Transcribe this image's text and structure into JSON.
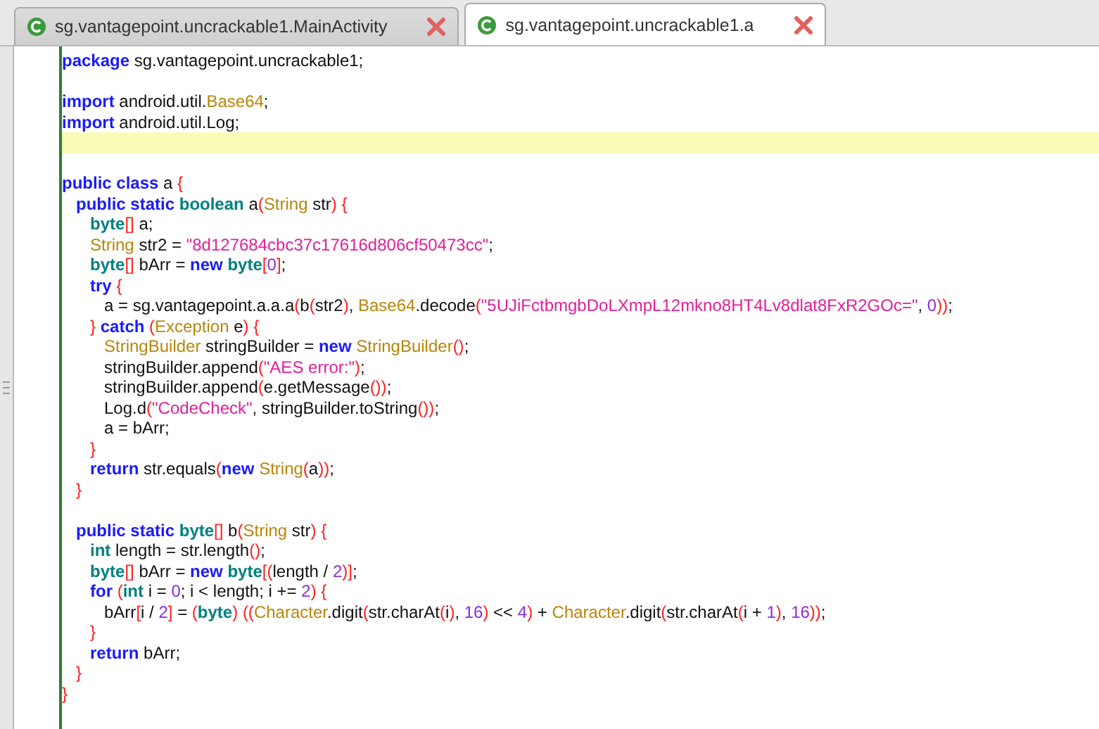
{
  "tabs": [
    {
      "label": "sg.vantagepoint.uncrackable1.MainActivity",
      "selected": false
    },
    {
      "label": "sg.vantagepoint.uncrackable1.a",
      "selected": true
    }
  ],
  "editor": {
    "lines": [
      {
        "highlighted": false,
        "tokens": [
          {
            "kind": "kw",
            "text": "package"
          },
          {
            "kind": "plain",
            "text": " sg.vantagepoint.uncrackable1;"
          }
        ]
      },
      {
        "highlighted": false
      },
      {
        "highlighted": false,
        "tokens": [
          {
            "kind": "kw",
            "text": "import"
          },
          {
            "kind": "plain",
            "text": " android.util."
          },
          {
            "kind": "cls",
            "text": "Base64"
          },
          {
            "kind": "plain",
            "text": ";"
          }
        ]
      },
      {
        "highlighted": false,
        "tokens": [
          {
            "kind": "kw",
            "text": "import"
          },
          {
            "kind": "plain",
            "text": " android.util.Log;"
          }
        ]
      },
      {
        "highlighted": true
      },
      {
        "highlighted": false
      },
      {
        "highlighted": false,
        "tokens": [
          {
            "kind": "kw",
            "text": "public class"
          },
          {
            "kind": "plain",
            "text": " a "
          },
          {
            "kind": "punc",
            "text": "{"
          }
        ]
      },
      {
        "highlighted": false,
        "tokens": [
          {
            "kind": "kw",
            "text": "   public static "
          },
          {
            "kind": "type",
            "text": "boolean"
          },
          {
            "kind": "plain",
            "text": " a"
          },
          {
            "kind": "punc",
            "text": "("
          },
          {
            "kind": "cls",
            "text": "String"
          },
          {
            "kind": "plain",
            "text": " str"
          },
          {
            "kind": "punc",
            "text": ") {"
          }
        ]
      },
      {
        "highlighted": false,
        "tokens": [
          {
            "kind": "type",
            "text": "      byte"
          },
          {
            "kind": "punc",
            "text": "[]"
          },
          {
            "kind": "plain",
            "text": " a;"
          }
        ]
      },
      {
        "highlighted": false,
        "tokens": [
          {
            "kind": "cls",
            "text": "      String"
          },
          {
            "kind": "plain",
            "text": " str2 = "
          },
          {
            "kind": "str",
            "text": "\"8d127684cbc37c17616d806cf50473cc\""
          },
          {
            "kind": "plain",
            "text": ";"
          }
        ]
      },
      {
        "highlighted": false,
        "tokens": [
          {
            "kind": "type",
            "text": "      byte"
          },
          {
            "kind": "punc",
            "text": "[]"
          },
          {
            "kind": "plain",
            "text": " bArr = "
          },
          {
            "kind": "kw",
            "text": "new "
          },
          {
            "kind": "type",
            "text": "byte"
          },
          {
            "kind": "punc",
            "text": "["
          },
          {
            "kind": "num",
            "text": "0"
          },
          {
            "kind": "punc",
            "text": "]"
          },
          {
            "kind": "plain",
            "text": ";"
          }
        ]
      },
      {
        "highlighted": false,
        "tokens": [
          {
            "kind": "kw",
            "text": "      try "
          },
          {
            "kind": "punc",
            "text": "{"
          }
        ]
      },
      {
        "highlighted": false,
        "tokens": [
          {
            "kind": "plain",
            "text": "         a = sg.vantagepoint.a.a.a"
          },
          {
            "kind": "punc",
            "text": "("
          },
          {
            "kind": "plain",
            "text": "b"
          },
          {
            "kind": "punc",
            "text": "("
          },
          {
            "kind": "plain",
            "text": "str2"
          },
          {
            "kind": "punc",
            "text": ")"
          },
          {
            "kind": "plain",
            "text": ", "
          },
          {
            "kind": "cls",
            "text": "Base64"
          },
          {
            "kind": "plain",
            "text": ".decode"
          },
          {
            "kind": "punc",
            "text": "("
          },
          {
            "kind": "str",
            "text": "\"5UJiFctbmgbDoLXmpL12mkno8HT4Lv8dlat8FxR2GOc=\""
          },
          {
            "kind": "plain",
            "text": ", "
          },
          {
            "kind": "num",
            "text": "0"
          },
          {
            "kind": "punc",
            "text": "))"
          },
          {
            "kind": "plain",
            "text": ";"
          }
        ]
      },
      {
        "highlighted": false,
        "tokens": [
          {
            "kind": "punc",
            "text": "      } "
          },
          {
            "kind": "kw",
            "text": "catch "
          },
          {
            "kind": "punc",
            "text": "("
          },
          {
            "kind": "cls",
            "text": "Exception"
          },
          {
            "kind": "plain",
            "text": " e"
          },
          {
            "kind": "punc",
            "text": ") {"
          }
        ]
      },
      {
        "highlighted": false,
        "tokens": [
          {
            "kind": "cls",
            "text": "         StringBuilder"
          },
          {
            "kind": "plain",
            "text": " stringBuilder = "
          },
          {
            "kind": "kw",
            "text": "new "
          },
          {
            "kind": "cls",
            "text": "StringBuilder"
          },
          {
            "kind": "punc",
            "text": "()"
          },
          {
            "kind": "plain",
            "text": ";"
          }
        ]
      },
      {
        "highlighted": false,
        "tokens": [
          {
            "kind": "plain",
            "text": "         stringBuilder.append"
          },
          {
            "kind": "punc",
            "text": "("
          },
          {
            "kind": "str",
            "text": "\"AES error:\""
          },
          {
            "kind": "punc",
            "text": ")"
          },
          {
            "kind": "plain",
            "text": ";"
          }
        ]
      },
      {
        "highlighted": false,
        "tokens": [
          {
            "kind": "plain",
            "text": "         stringBuilder.append"
          },
          {
            "kind": "punc",
            "text": "("
          },
          {
            "kind": "plain",
            "text": "e.getMessage"
          },
          {
            "kind": "punc",
            "text": "())"
          },
          {
            "kind": "plain",
            "text": ";"
          }
        ]
      },
      {
        "highlighted": false,
        "tokens": [
          {
            "kind": "plain",
            "text": "         Log.d"
          },
          {
            "kind": "punc",
            "text": "("
          },
          {
            "kind": "str",
            "text": "\"CodeCheck\""
          },
          {
            "kind": "plain",
            "text": ", stringBuilder.toString"
          },
          {
            "kind": "punc",
            "text": "())"
          },
          {
            "kind": "plain",
            "text": ";"
          }
        ]
      },
      {
        "highlighted": false,
        "tokens": [
          {
            "kind": "plain",
            "text": "         a = bArr;"
          }
        ]
      },
      {
        "highlighted": false,
        "tokens": [
          {
            "kind": "punc",
            "text": "      }"
          }
        ]
      },
      {
        "highlighted": false,
        "tokens": [
          {
            "kind": "kw",
            "text": "      return"
          },
          {
            "kind": "plain",
            "text": " str.equals"
          },
          {
            "kind": "punc",
            "text": "("
          },
          {
            "kind": "kw",
            "text": "new "
          },
          {
            "kind": "cls",
            "text": "String"
          },
          {
            "kind": "punc",
            "text": "("
          },
          {
            "kind": "plain",
            "text": "a"
          },
          {
            "kind": "punc",
            "text": "))"
          },
          {
            "kind": "plain",
            "text": ";"
          }
        ]
      },
      {
        "highlighted": false,
        "tokens": [
          {
            "kind": "punc",
            "text": "   }"
          }
        ]
      },
      {
        "highlighted": false
      },
      {
        "highlighted": false,
        "tokens": [
          {
            "kind": "kw",
            "text": "   public static "
          },
          {
            "kind": "type",
            "text": "byte"
          },
          {
            "kind": "punc",
            "text": "[]"
          },
          {
            "kind": "plain",
            "text": " b"
          },
          {
            "kind": "punc",
            "text": "("
          },
          {
            "kind": "cls",
            "text": "String"
          },
          {
            "kind": "plain",
            "text": " str"
          },
          {
            "kind": "punc",
            "text": ") {"
          }
        ]
      },
      {
        "highlighted": false,
        "tokens": [
          {
            "kind": "type",
            "text": "      int"
          },
          {
            "kind": "plain",
            "text": " length = str.length"
          },
          {
            "kind": "punc",
            "text": "()"
          },
          {
            "kind": "plain",
            "text": ";"
          }
        ]
      },
      {
        "highlighted": false,
        "tokens": [
          {
            "kind": "type",
            "text": "      byte"
          },
          {
            "kind": "punc",
            "text": "[]"
          },
          {
            "kind": "plain",
            "text": " bArr = "
          },
          {
            "kind": "kw",
            "text": "new "
          },
          {
            "kind": "type",
            "text": "byte"
          },
          {
            "kind": "punc",
            "text": "[("
          },
          {
            "kind": "plain",
            "text": "length / "
          },
          {
            "kind": "num",
            "text": "2"
          },
          {
            "kind": "punc",
            "text": ")]"
          },
          {
            "kind": "plain",
            "text": ";"
          }
        ]
      },
      {
        "highlighted": false,
        "tokens": [
          {
            "kind": "kw",
            "text": "      for "
          },
          {
            "kind": "punc",
            "text": "("
          },
          {
            "kind": "type",
            "text": "int"
          },
          {
            "kind": "plain",
            "text": " i = "
          },
          {
            "kind": "num",
            "text": "0"
          },
          {
            "kind": "plain",
            "text": "; i < length; i += "
          },
          {
            "kind": "num",
            "text": "2"
          },
          {
            "kind": "punc",
            "text": ") {"
          }
        ]
      },
      {
        "highlighted": false,
        "tokens": [
          {
            "kind": "plain",
            "text": "         bArr"
          },
          {
            "kind": "punc",
            "text": "["
          },
          {
            "kind": "plain",
            "text": "i / "
          },
          {
            "kind": "num",
            "text": "2"
          },
          {
            "kind": "punc",
            "text": "]"
          },
          {
            "kind": "plain",
            "text": " = "
          },
          {
            "kind": "punc",
            "text": "("
          },
          {
            "kind": "type",
            "text": "byte"
          },
          {
            "kind": "punc",
            "text": ") (("
          },
          {
            "kind": "cls",
            "text": "Character"
          },
          {
            "kind": "plain",
            "text": ".digit"
          },
          {
            "kind": "punc",
            "text": "("
          },
          {
            "kind": "plain",
            "text": "str.charAt"
          },
          {
            "kind": "punc",
            "text": "("
          },
          {
            "kind": "plain",
            "text": "i"
          },
          {
            "kind": "punc",
            "text": ")"
          },
          {
            "kind": "plain",
            "text": ", "
          },
          {
            "kind": "num",
            "text": "16"
          },
          {
            "kind": "punc",
            "text": ")"
          },
          {
            "kind": "plain",
            "text": " << "
          },
          {
            "kind": "num",
            "text": "4"
          },
          {
            "kind": "punc",
            "text": ")"
          },
          {
            "kind": "plain",
            "text": " + "
          },
          {
            "kind": "cls",
            "text": "Character"
          },
          {
            "kind": "plain",
            "text": ".digit"
          },
          {
            "kind": "punc",
            "text": "("
          },
          {
            "kind": "plain",
            "text": "str.charAt"
          },
          {
            "kind": "punc",
            "text": "("
          },
          {
            "kind": "plain",
            "text": "i + "
          },
          {
            "kind": "num",
            "text": "1"
          },
          {
            "kind": "punc",
            "text": ")"
          },
          {
            "kind": "plain",
            "text": ", "
          },
          {
            "kind": "num",
            "text": "16"
          },
          {
            "kind": "punc",
            "text": "))"
          },
          {
            "kind": "plain",
            "text": ";"
          }
        ]
      },
      {
        "highlighted": false,
        "tokens": [
          {
            "kind": "punc",
            "text": "      }"
          }
        ]
      },
      {
        "highlighted": false,
        "tokens": [
          {
            "kind": "kw",
            "text": "      return"
          },
          {
            "kind": "plain",
            "text": " bArr;"
          }
        ]
      },
      {
        "highlighted": false,
        "tokens": [
          {
            "kind": "punc",
            "text": "   }"
          }
        ]
      },
      {
        "highlighted": false,
        "tokens": [
          {
            "kind": "punc",
            "text": "}"
          }
        ]
      }
    ]
  }
}
